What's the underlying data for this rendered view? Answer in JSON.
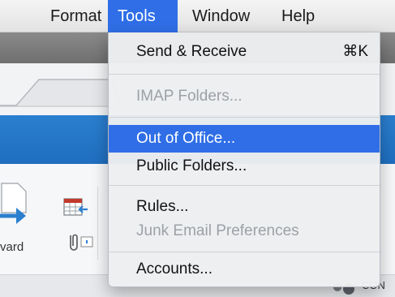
{
  "menubar": {
    "items": [
      {
        "label": "Format"
      },
      {
        "label": "Tools"
      },
      {
        "label": "Window"
      },
      {
        "label": "Help"
      }
    ],
    "active": "Tools"
  },
  "menu": {
    "items": [
      {
        "label": "Send & Receive",
        "shortcut": "⌘K",
        "state": "enabled"
      },
      {
        "label": "IMAP Folders...",
        "state": "disabled"
      },
      {
        "label": "Out of Office...",
        "state": "highlighted"
      },
      {
        "label": "Public Folders...",
        "state": "enabled"
      },
      {
        "label": "Rules...",
        "state": "enabled"
      },
      {
        "label": "Junk Email Preferences",
        "state": "disabled"
      },
      {
        "label": "Accounts...",
        "state": "enabled"
      }
    ]
  },
  "background": {
    "forward_label": "vard",
    "conversation_label": "CON"
  },
  "colors": {
    "highlight": "#2f6ee6",
    "ribbon": "#2b7fcf"
  }
}
